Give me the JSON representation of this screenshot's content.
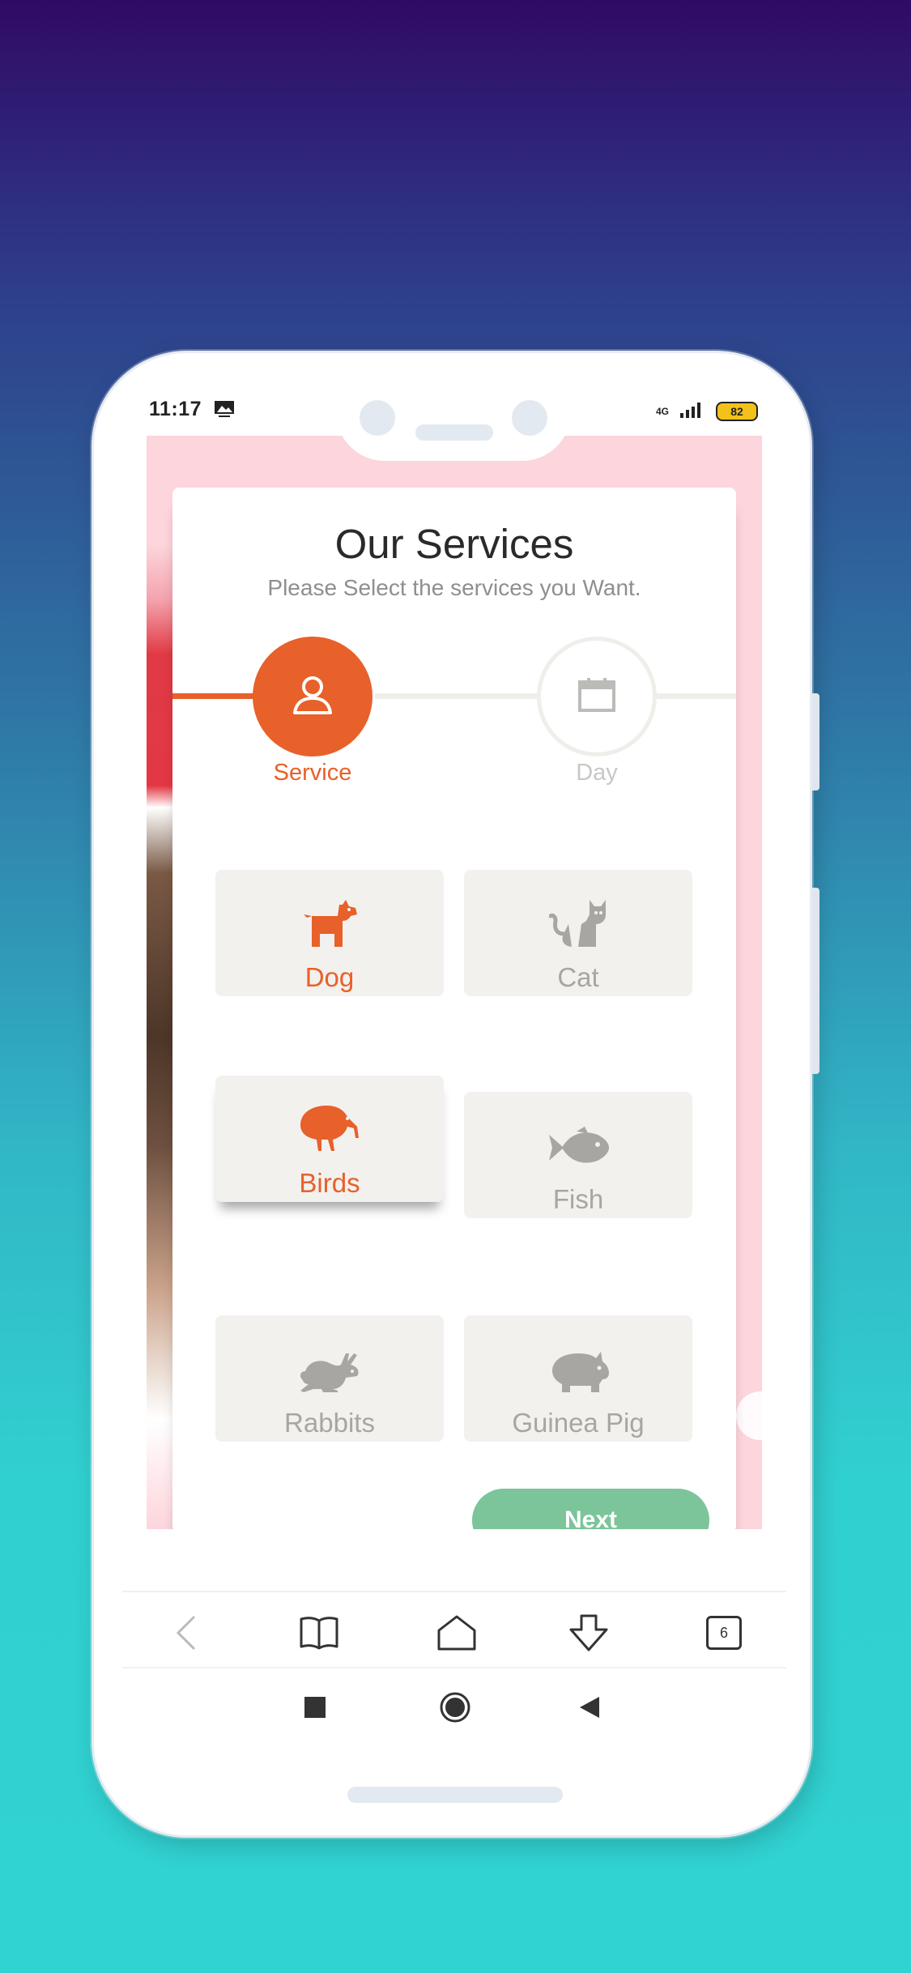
{
  "status_bar": {
    "time": "11:17",
    "network": "4G",
    "battery": "82"
  },
  "header": {
    "title": "Our Services",
    "subtitle": "Please Select the services you Want."
  },
  "steps": [
    {
      "label": "Service",
      "icon": "user-icon",
      "state": "active"
    },
    {
      "label": "Day",
      "icon": "calendar-icon",
      "state": "inactive"
    }
  ],
  "services": [
    {
      "label": "Dog",
      "icon": "dog-icon",
      "selected": true
    },
    {
      "label": "Cat",
      "icon": "cat-icon",
      "selected": false
    },
    {
      "label": "Birds",
      "icon": "bird-icon",
      "selected": true
    },
    {
      "label": "Fish",
      "icon": "fish-icon",
      "selected": false
    },
    {
      "label": "Rabbits",
      "icon": "rabbit-icon",
      "selected": false
    },
    {
      "label": "Guinea Pig",
      "icon": "pig-icon",
      "selected": false
    }
  ],
  "actions": {
    "next_label": "Next"
  },
  "browser_bar": {
    "tab_count": "6"
  },
  "colors": {
    "accent": "#e8602a",
    "inactive": "#a8a6a3",
    "tile_bg": "#f2f1ee",
    "next_button": "#7cc49a"
  }
}
